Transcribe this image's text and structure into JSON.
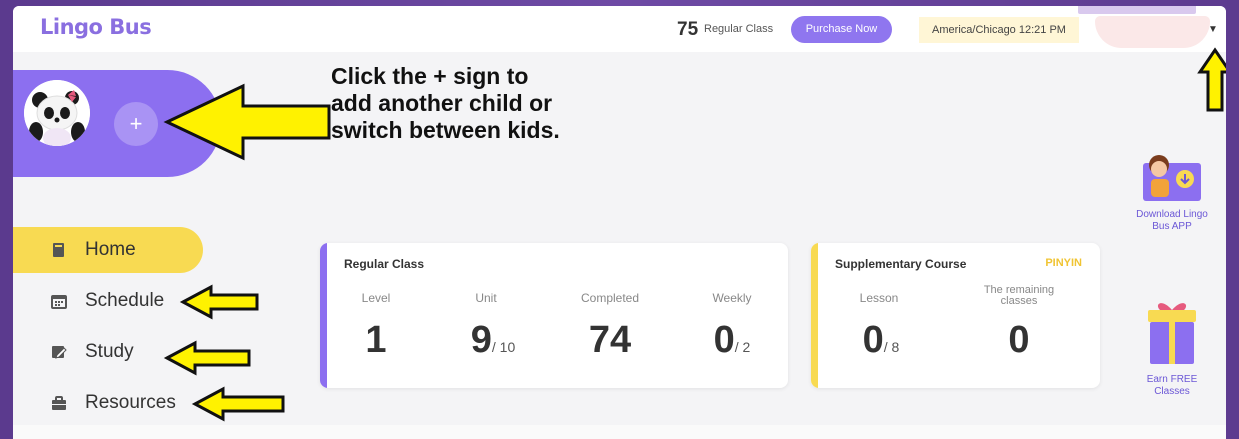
{
  "header": {
    "logo": "Lingo Bus",
    "class_count": "75",
    "class_label": "Regular Class",
    "purchase_label": "Purchase Now",
    "timezone": "America/Chicago 12:21 PM",
    "dropdown_icon": "caret-down-icon"
  },
  "profile": {
    "add_label": "+"
  },
  "annotation": {
    "text": "Click the + sign to add another child or switch between kids."
  },
  "nav": {
    "items": [
      {
        "label": "Home",
        "icon": "book-icon",
        "active": true
      },
      {
        "label": "Schedule",
        "icon": "calendar-icon",
        "active": false
      },
      {
        "label": "Study",
        "icon": "pencil-icon",
        "active": false
      },
      {
        "label": "Resources",
        "icon": "briefcase-icon",
        "active": false
      }
    ]
  },
  "regular_card": {
    "title": "Regular Class",
    "accent": "#8c6ff0",
    "level_label": "Level",
    "level_value": "1",
    "unit_label": "Unit",
    "unit_value": "9",
    "unit_total": "/ 10",
    "completed_label": "Completed",
    "completed_value": "74",
    "weekly_label": "Weekly",
    "weekly_value": "0",
    "weekly_total": "/ 2"
  },
  "supplementary_card": {
    "title": "Supplementary Course",
    "tag": "PINYIN",
    "accent": "#f8da52",
    "lesson_label": "Lesson",
    "lesson_value": "0",
    "lesson_total": "/ 8",
    "remaining_label": "The remaining classes",
    "remaining_value": "0"
  },
  "promos": {
    "download_label": "Download Lingo Bus APP",
    "earn_label": "Earn FREE Classes"
  },
  "colors": {
    "brand_purple": "#8c6ff0",
    "highlight_yellow": "#f8da52",
    "arrow_yellow": "#fff200"
  }
}
